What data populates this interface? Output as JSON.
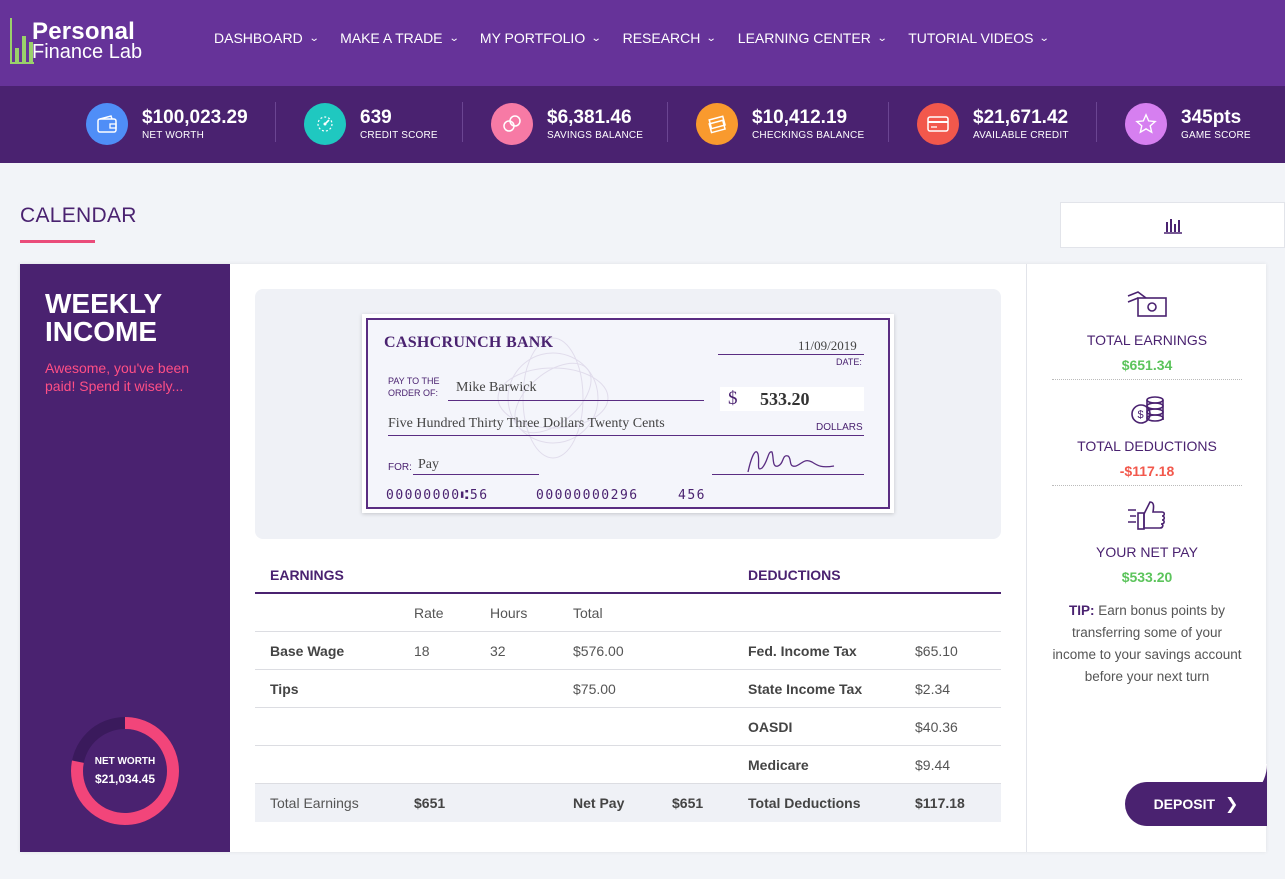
{
  "brand": {
    "line1": "Personal",
    "line2": "Finance Lab"
  },
  "nav": [
    {
      "label": "DASHBOARD"
    },
    {
      "label": "MAKE A TRADE"
    },
    {
      "label": "MY PORTFOLIO"
    },
    {
      "label": "RESEARCH"
    },
    {
      "label": "LEARNING CENTER"
    },
    {
      "label": "TUTORIAL VIDEOS"
    }
  ],
  "stats": [
    {
      "value": "$100,023.29",
      "label": "NET WORTH",
      "color": "#4f8ef7",
      "icon": "wallet-icon"
    },
    {
      "value": "639",
      "label": "CREDIT SCORE",
      "color": "#1fc8c0",
      "icon": "speedometer-icon"
    },
    {
      "value": "$6,381.46",
      "label": "SAVINGS BALANCE",
      "color": "#f77aa5",
      "icon": "coins-icon"
    },
    {
      "value": "$10,412.19",
      "label": "CHECKINGS BALANCE",
      "color": "#f99a2e",
      "icon": "cash-stack-icon"
    },
    {
      "value": "$21,671.42",
      "label": "AVAILABLE CREDIT",
      "color": "#f2584c",
      "icon": "credit-card-icon"
    },
    {
      "value": "345pts",
      "label": "GAME SCORE",
      "color": "#d67ff0",
      "icon": "star-icon"
    }
  ],
  "page": {
    "title": "CALENDAR"
  },
  "weekly": {
    "title": "WEEKLY INCOME",
    "subtitle": "Awesome, you've been paid! Spend it wisely...",
    "donut_label": "NET WORTH",
    "donut_value": "$21,034.45",
    "donut_fraction": 0.78,
    "donut_color": "#f2457a"
  },
  "check": {
    "bank": "CASHCRUNCH BANK",
    "date": "11/09/2019",
    "date_label": "DATE:",
    "payto_label1": "PAY TO THE",
    "payto_label2": "ORDER OF:",
    "payee": "Mike Barwick",
    "dollar_sign": "$",
    "amount": "533.20",
    "amount_words": "Five Hundred Thirty Three Dollars Twenty Cents",
    "dollars_label": "DOLLARS",
    "for_label": "FOR:",
    "memo": "Pay",
    "micr1": "00000000⑆56",
    "micr2": "00000000296",
    "micr3": "456"
  },
  "table": {
    "earnings_header": "EARNINGS",
    "deductions_header": "DEDUCTIONS",
    "col_rate": "Rate",
    "col_hours": "Hours",
    "col_total": "Total",
    "rows": [
      {
        "earn": "Base Wage",
        "rate": "18",
        "hours": "32",
        "total": "$576.00",
        "ded": "Fed. Income Tax",
        "amt": "$65.10"
      },
      {
        "earn": "Tips",
        "rate": "",
        "hours": "",
        "total": "$75.00",
        "ded": "State Income Tax",
        "amt": "$2.34"
      },
      {
        "earn": "",
        "rate": "",
        "hours": "",
        "total": "",
        "ded": "OASDI",
        "amt": "$40.36"
      },
      {
        "earn": "",
        "rate": "",
        "hours": "",
        "total": "",
        "ded": "Medicare",
        "amt": "$9.44"
      }
    ],
    "totals": {
      "earn_label": "Total Earnings",
      "earn_value": "$651",
      "net_label": "Net Pay",
      "net_value": "$651",
      "ded_label": "Total Deductions",
      "ded_value": "$117.18"
    }
  },
  "summary": {
    "earnings_label": "TOTAL EARNINGS",
    "earnings_value": "$651.34",
    "deductions_label": "TOTAL DEDUCTIONS",
    "deductions_value": "-$117.18",
    "net_label": "YOUR NET PAY",
    "net_value": "$533.20",
    "tip_label": "TIP:",
    "tip_text": " Earn bonus points by transferring some of your income to your savings account before your next turn",
    "deposit_label": "DEPOSIT",
    "positive_color": "#5cc45c",
    "negative_color": "#f2584c"
  }
}
